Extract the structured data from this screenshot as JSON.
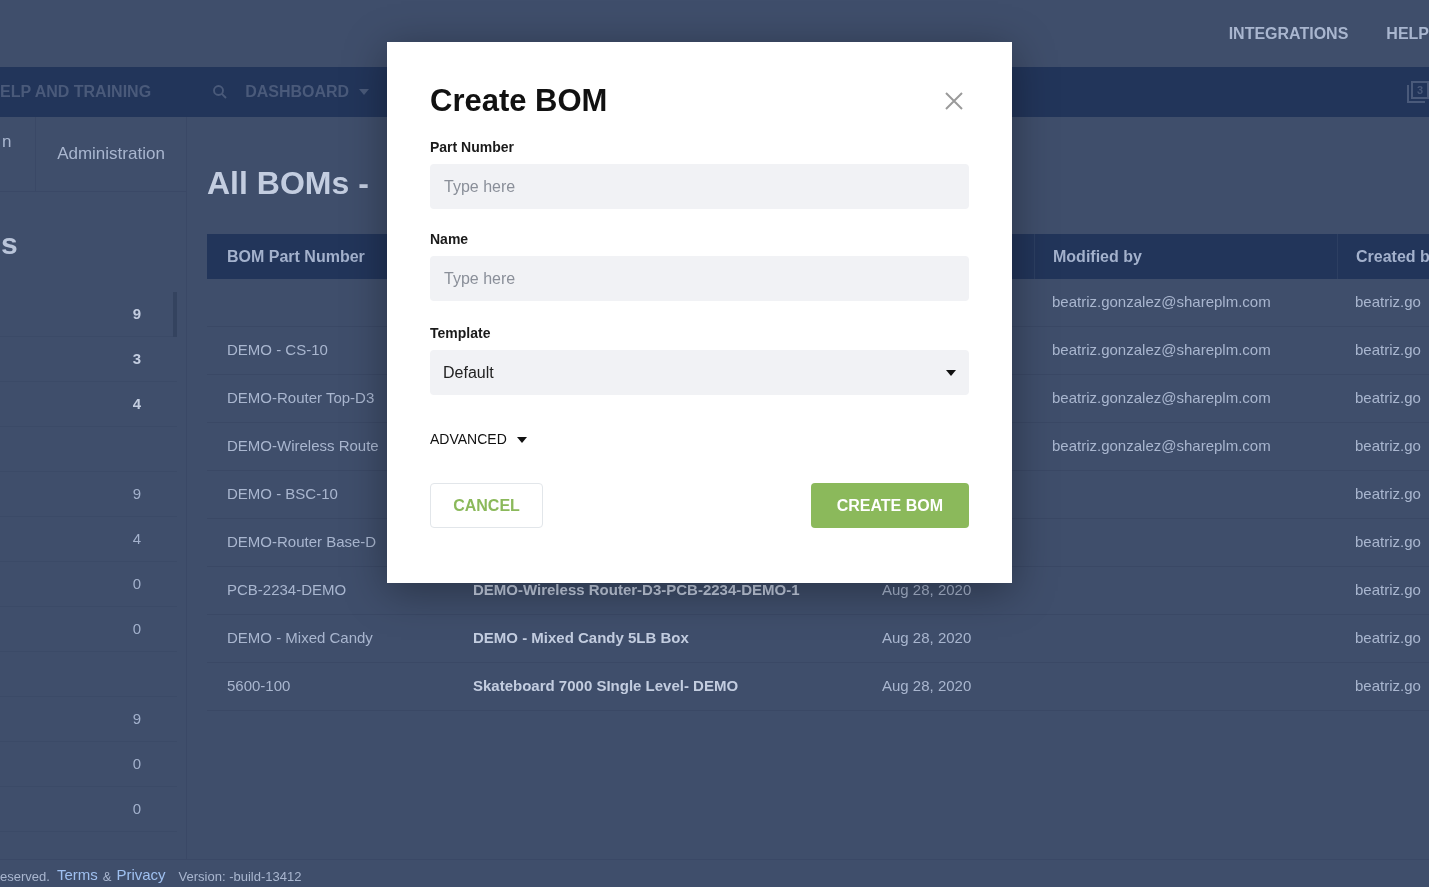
{
  "top_bar": {
    "links": [
      "INTEGRATIONS",
      "HELP"
    ]
  },
  "nav_bar": {
    "items": [
      {
        "label": "ELP AND TRAINING",
        "kind": "link"
      },
      {
        "label": "DASHBOARD",
        "kind": "dropdown"
      }
    ],
    "badge": "3"
  },
  "sub_tabs": [
    {
      "label": "n",
      "selected": false
    },
    {
      "label": "Administration",
      "selected": false
    }
  ],
  "sidebar": {
    "heading": "s",
    "rows": [
      {
        "kind": "total",
        "count": "9"
      },
      {
        "kind": "total",
        "count": "3"
      },
      {
        "kind": "total",
        "count": "4"
      },
      {
        "kind": "blank"
      },
      {
        "kind": "item",
        "count": "9"
      },
      {
        "kind": "item",
        "count": "4"
      },
      {
        "kind": "item",
        "count": "0"
      },
      {
        "kind": "item",
        "count": "0"
      },
      {
        "kind": "blank"
      },
      {
        "kind": "item",
        "count": "9"
      },
      {
        "kind": "item",
        "count": "0"
      },
      {
        "kind": "item",
        "count": "0"
      }
    ]
  },
  "main": {
    "title": "All BOMs -",
    "table": {
      "columns": {
        "part_number": "BOM Part Number",
        "modified_by": "Modified by",
        "created_by": "Created b"
      },
      "rows": [
        {
          "modified_by": "beatriz.gonzalez@shareplm.com",
          "created_by": "beatriz.go"
        },
        {
          "part_number": "DEMO - CS-10",
          "modified_by": "beatriz.gonzalez@shareplm.com",
          "created_by": "beatriz.go"
        },
        {
          "part_number": "DEMO-Router Top-D3",
          "modified_by": "beatriz.gonzalez@shareplm.com",
          "created_by": "beatriz.go"
        },
        {
          "part_number": "DEMO-Wireless Route",
          "modified_by": "beatriz.gonzalez@shareplm.com",
          "created_by": "beatriz.go"
        },
        {
          "part_number": "DEMO - BSC-10",
          "created_by": "beatriz.go"
        },
        {
          "part_number": "DEMO-Router Base-D",
          "created_by": "beatriz.go"
        },
        {
          "part_number": "PCB-2234-DEMO",
          "name": "DEMO-Wireless Router-D3-PCB-2234-DEMO-1",
          "date": "Aug 28, 2020",
          "created_by": "beatriz.go"
        },
        {
          "part_number": "DEMO - Mixed Candy",
          "name": "DEMO - Mixed Candy 5LB Box",
          "date": "Aug 28, 2020",
          "created_by": "beatriz.go"
        },
        {
          "part_number": "5600-100",
          "name": "Skateboard 7000 SIngle Level- DEMO",
          "date": "Aug 28, 2020",
          "created_by": "beatriz.go"
        }
      ]
    }
  },
  "footer": {
    "notice": "eserved.",
    "terms": "Terms",
    "amp": "&",
    "privacy": "Privacy",
    "version": "Version: -build-13412"
  },
  "modal": {
    "title": "Create BOM",
    "fields": [
      {
        "label": "Part Number",
        "kind": "text",
        "placeholder": "Type here"
      },
      {
        "label": "Name",
        "kind": "text",
        "placeholder": "Type here"
      },
      {
        "label": "Template",
        "kind": "select",
        "value": "Default"
      }
    ],
    "advanced": {
      "label": "ADVANCED",
      "expanded": false
    },
    "buttons": [
      {
        "label": "CANCEL",
        "kind": "secondary"
      },
      {
        "label": "CREATE BOM",
        "kind": "primary"
      }
    ]
  }
}
